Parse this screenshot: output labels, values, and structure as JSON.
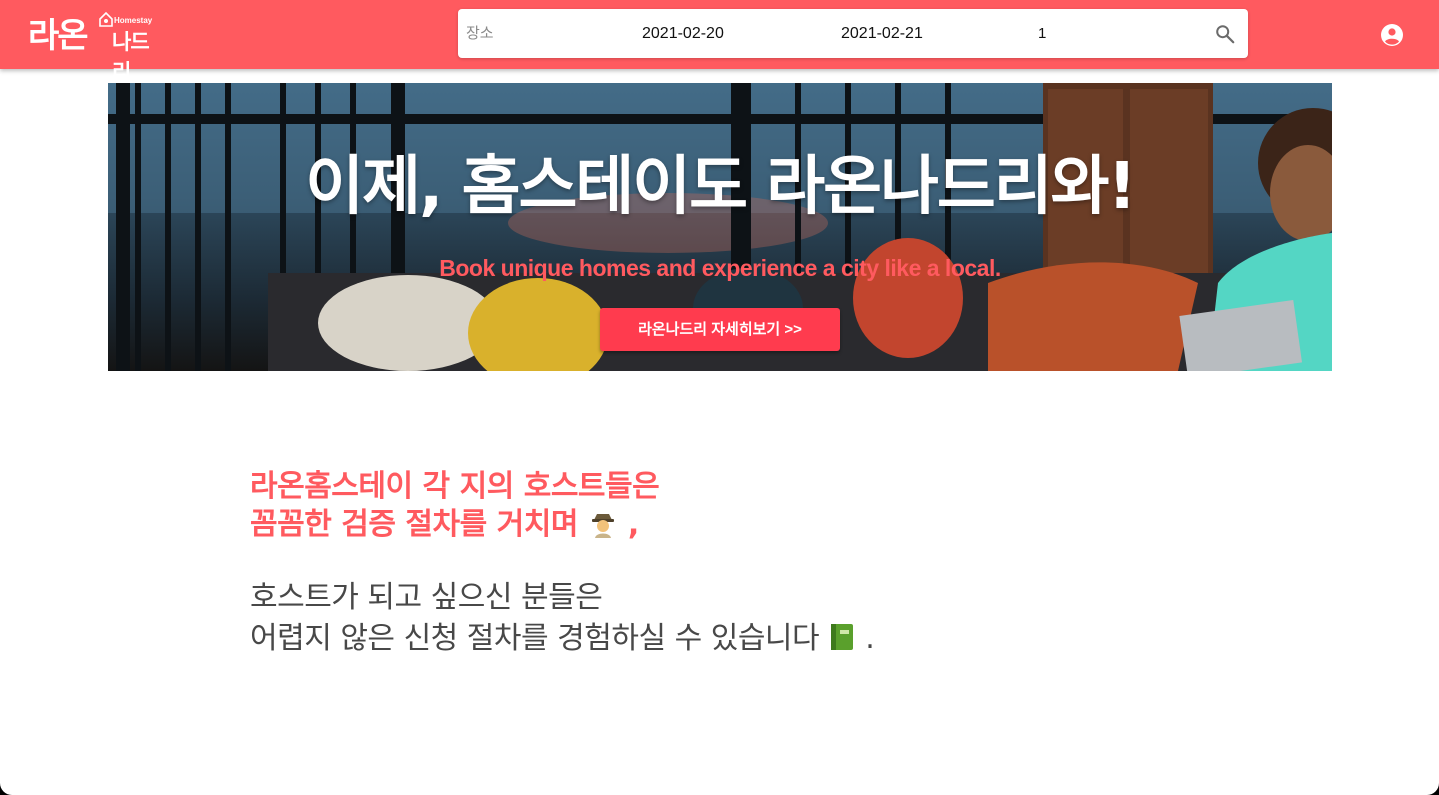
{
  "header": {
    "logo_main": "라온",
    "logo_sub": "나드리",
    "logo_small": "Homestay",
    "search": {
      "place_placeholder": "장소",
      "checkin": "2021-02-20",
      "checkout": "2021-02-21",
      "guests": "1"
    }
  },
  "banner": {
    "title": "이제, 홈스테이도 라온나드리와!",
    "subtitle": "Book unique homes and experience a city like a local.",
    "button_label": "라온나드리 자세히보기 >>"
  },
  "host_section": {
    "title_line1": "라온홈스테이 각 지의 호스트들은",
    "title_line2": "꼼꼼한 검증 절차를 거치며",
    "title_emoji": "detective-emoji",
    "title_end": ",",
    "body_line1": "호스트가 되고 싶으신 분들은",
    "body_line2": "어렵지 않은 신청 절차를 경험하실 수 있습니다",
    "body_emoji": "green-book-emoji",
    "body_end": "."
  },
  "colors": {
    "brand": "#ff5a5f",
    "button": "#ff3b4e",
    "body_text": "#484848"
  },
  "icons": [
    "home-icon",
    "search-icon",
    "account-circle-icon"
  ]
}
